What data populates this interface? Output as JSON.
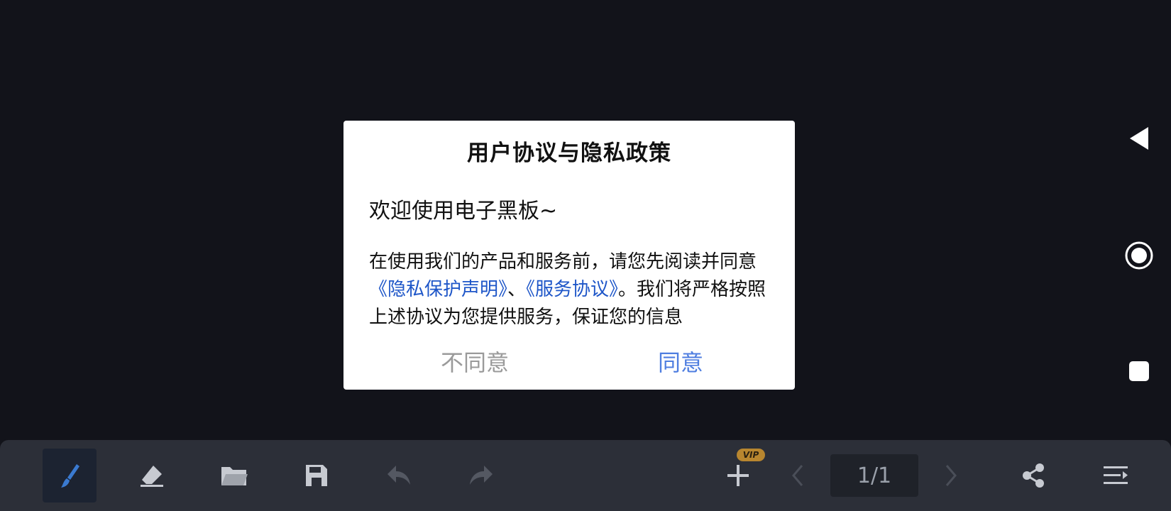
{
  "dialog": {
    "title": "用户协议与隐私政策",
    "welcome": "欢迎使用电子黑板~",
    "body_pre": "在使用我们的产品和服务前，请您先阅读并同意",
    "link_privacy": "《隐私保护声明》",
    "separator": "、",
    "link_service": "《服务协议》",
    "body_post": "。我们将严格按照上述协议为您提供服务，保证您的信息",
    "disagree_label": "不同意",
    "agree_label": "同意"
  },
  "toolbar": {
    "vip_badge": "VIP",
    "page_indicator": "1/1"
  },
  "colors": {
    "background": "#12131a",
    "toolbar": "#2c2f38",
    "link": "#1e56c8",
    "agree": "#4f7ee0",
    "vip": "#b8862f"
  },
  "icons": {
    "nav": [
      "back-icon",
      "home-icon",
      "recents-icon"
    ],
    "tools": [
      "brush-icon",
      "eraser-icon",
      "folder-icon",
      "save-icon",
      "undo-icon",
      "redo-icon",
      "add-icon",
      "prev-icon",
      "next-icon",
      "share-icon",
      "menu-icon"
    ]
  }
}
